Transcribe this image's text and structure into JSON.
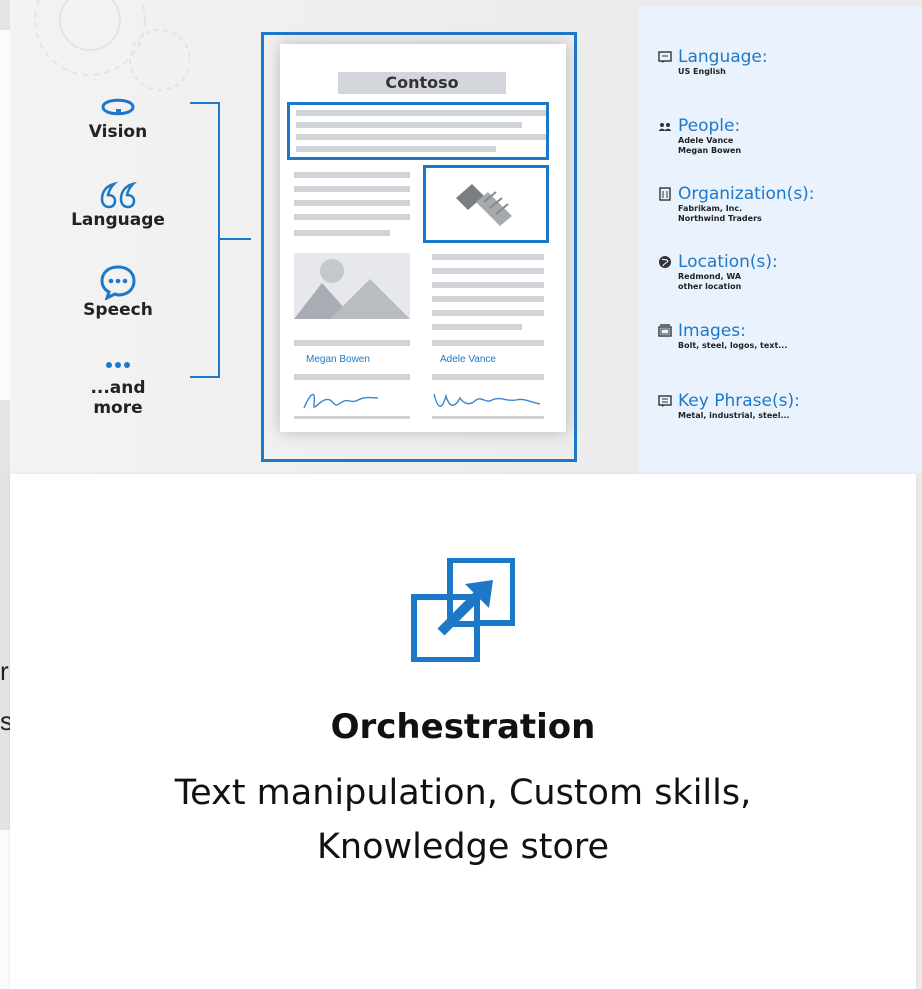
{
  "background": {
    "fragment_line1": "r",
    "fragment_line2": "s"
  },
  "diagram": {
    "features": [
      {
        "label": "Vision",
        "icon": "eye-icon"
      },
      {
        "label": "Language",
        "icon": "quote-icon"
      },
      {
        "label": "Speech",
        "icon": "speech-bubble-icon"
      },
      {
        "label": "...and more",
        "icon": "ellipsis-icon"
      }
    ],
    "document": {
      "title": "Contoso",
      "signer1": "Megan Bowen",
      "signer2": "Adele Vance"
    },
    "entities": [
      {
        "name": "Language:",
        "icon": "chat-bubble-icon",
        "values": [
          "US English"
        ]
      },
      {
        "name": "People:",
        "icon": "people-icon",
        "values": [
          "Adele Vance",
          "Megan Bowen"
        ]
      },
      {
        "name": "Organization(s):",
        "icon": "building-icon",
        "values": [
          "Fabrikam, Inc.",
          "Northwind Traders"
        ]
      },
      {
        "name": "Location(s):",
        "icon": "globe-icon",
        "values": [
          "Redmond, WA",
          "other location"
        ]
      },
      {
        "name": "Images:",
        "icon": "images-icon",
        "values": [
          "Bolt, steel, logos, text..."
        ]
      },
      {
        "name": "Key Phrase(s):",
        "icon": "key-phrase-icon",
        "values": [
          "Metal, industrial, steel..."
        ]
      }
    ],
    "colors": {
      "accent": "#1e78c8",
      "panel": "#eaf3fd"
    }
  },
  "card": {
    "icon": "orchestration-icon",
    "title": "Orchestration",
    "subtitle_line1": "Text manipulation, Custom skills,",
    "subtitle_line2": "Knowledge store"
  }
}
